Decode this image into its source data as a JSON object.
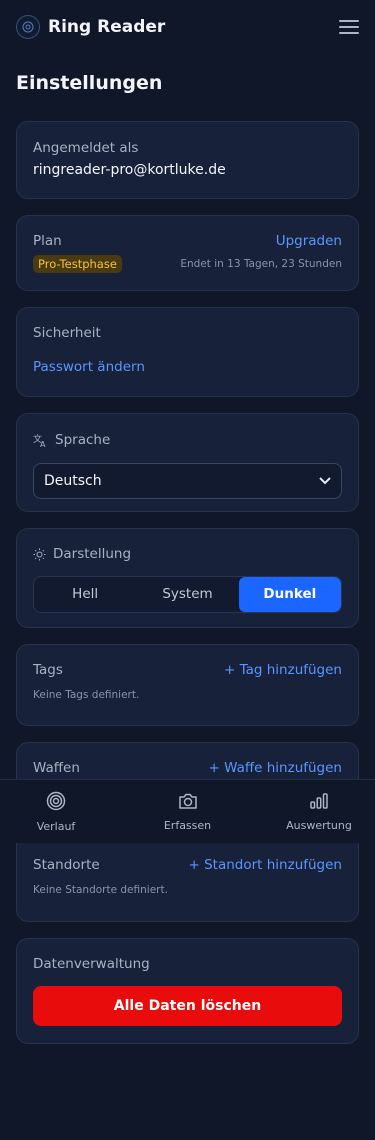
{
  "header": {
    "app_title": "Ring Reader"
  },
  "page_title": "Einstellungen",
  "account": {
    "label": "Angemeldet als",
    "email": "ringreader-pro@kortluke.de"
  },
  "plan": {
    "label": "Plan",
    "upgrade": "Upgraden",
    "badge": "Pro-Testphase",
    "ends": "Endet in 13 Tagen, 23 Stunden"
  },
  "security": {
    "label": "Sicherheit",
    "change_password": "Passwort ändern"
  },
  "language": {
    "label": "Sprache",
    "selected": "Deutsch",
    "icon": "translate-icon"
  },
  "appearance": {
    "label": "Darstellung",
    "options": [
      "Hell",
      "System",
      "Dunkel"
    ],
    "active": "Dunkel",
    "icon": "sun-icon"
  },
  "tags": {
    "label": "Tags",
    "add": "+ Tag hinzufügen",
    "empty": "Keine Tags definiert."
  },
  "weapons": {
    "label": "Waffen",
    "add": "+ Waffe hinzufügen"
  },
  "locations": {
    "label": "Standorte",
    "add": "+ Standort hinzufügen",
    "empty": "Keine Standorte definiert."
  },
  "data_management": {
    "label": "Datenverwaltung",
    "delete_all": "Alle Daten löschen"
  },
  "bottom_nav": [
    {
      "label": "Verlauf",
      "icon": "target-icon"
    },
    {
      "label": "Erfassen",
      "icon": "camera-icon"
    },
    {
      "label": "Auswertung",
      "icon": "bar-chart-icon"
    }
  ],
  "colors": {
    "accent": "#1b66ff",
    "link": "#5b95ff",
    "danger": "#e80c0c",
    "badge_text": "#f5c242",
    "background": "#0f1729",
    "card": "#17213a"
  }
}
